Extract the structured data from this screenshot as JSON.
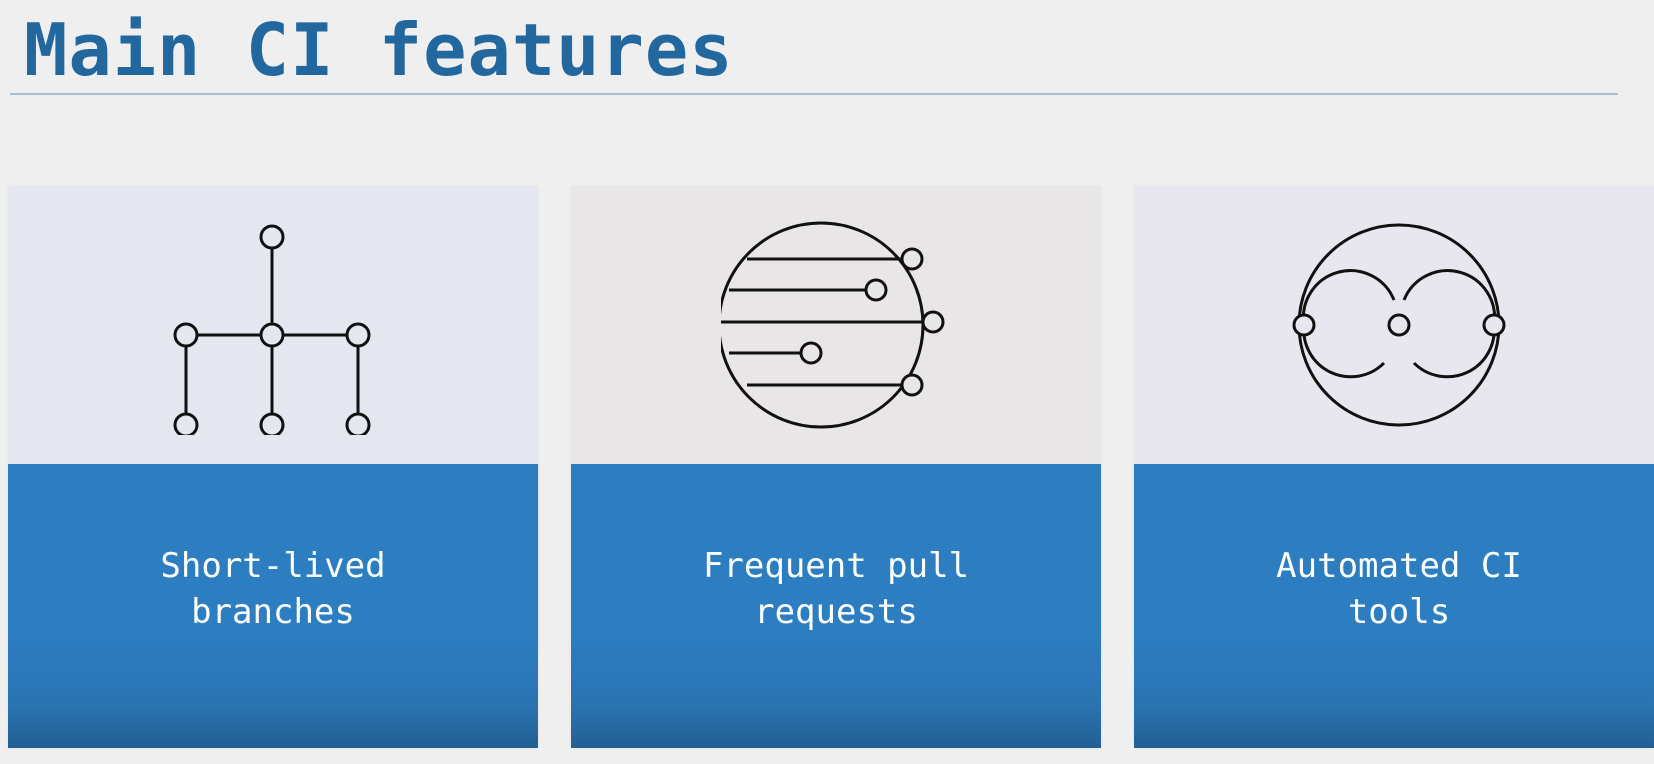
{
  "slide": {
    "title": "Main CI features"
  },
  "cards": [
    {
      "label": "Short-lived branches",
      "icon": "branch-tree-icon"
    },
    {
      "label": "Frequent pull requests",
      "icon": "pull-requests-circle-icon"
    },
    {
      "label": "Automated CI tools",
      "icon": "cycle-loop-icon"
    }
  ],
  "colors": {
    "title": "#23679f",
    "card_bottom": "#2d7dc1",
    "card_top_1": "#e4e7ef",
    "card_top_2": "#e8e6e7",
    "card_top_3": "#e8e7ef"
  }
}
